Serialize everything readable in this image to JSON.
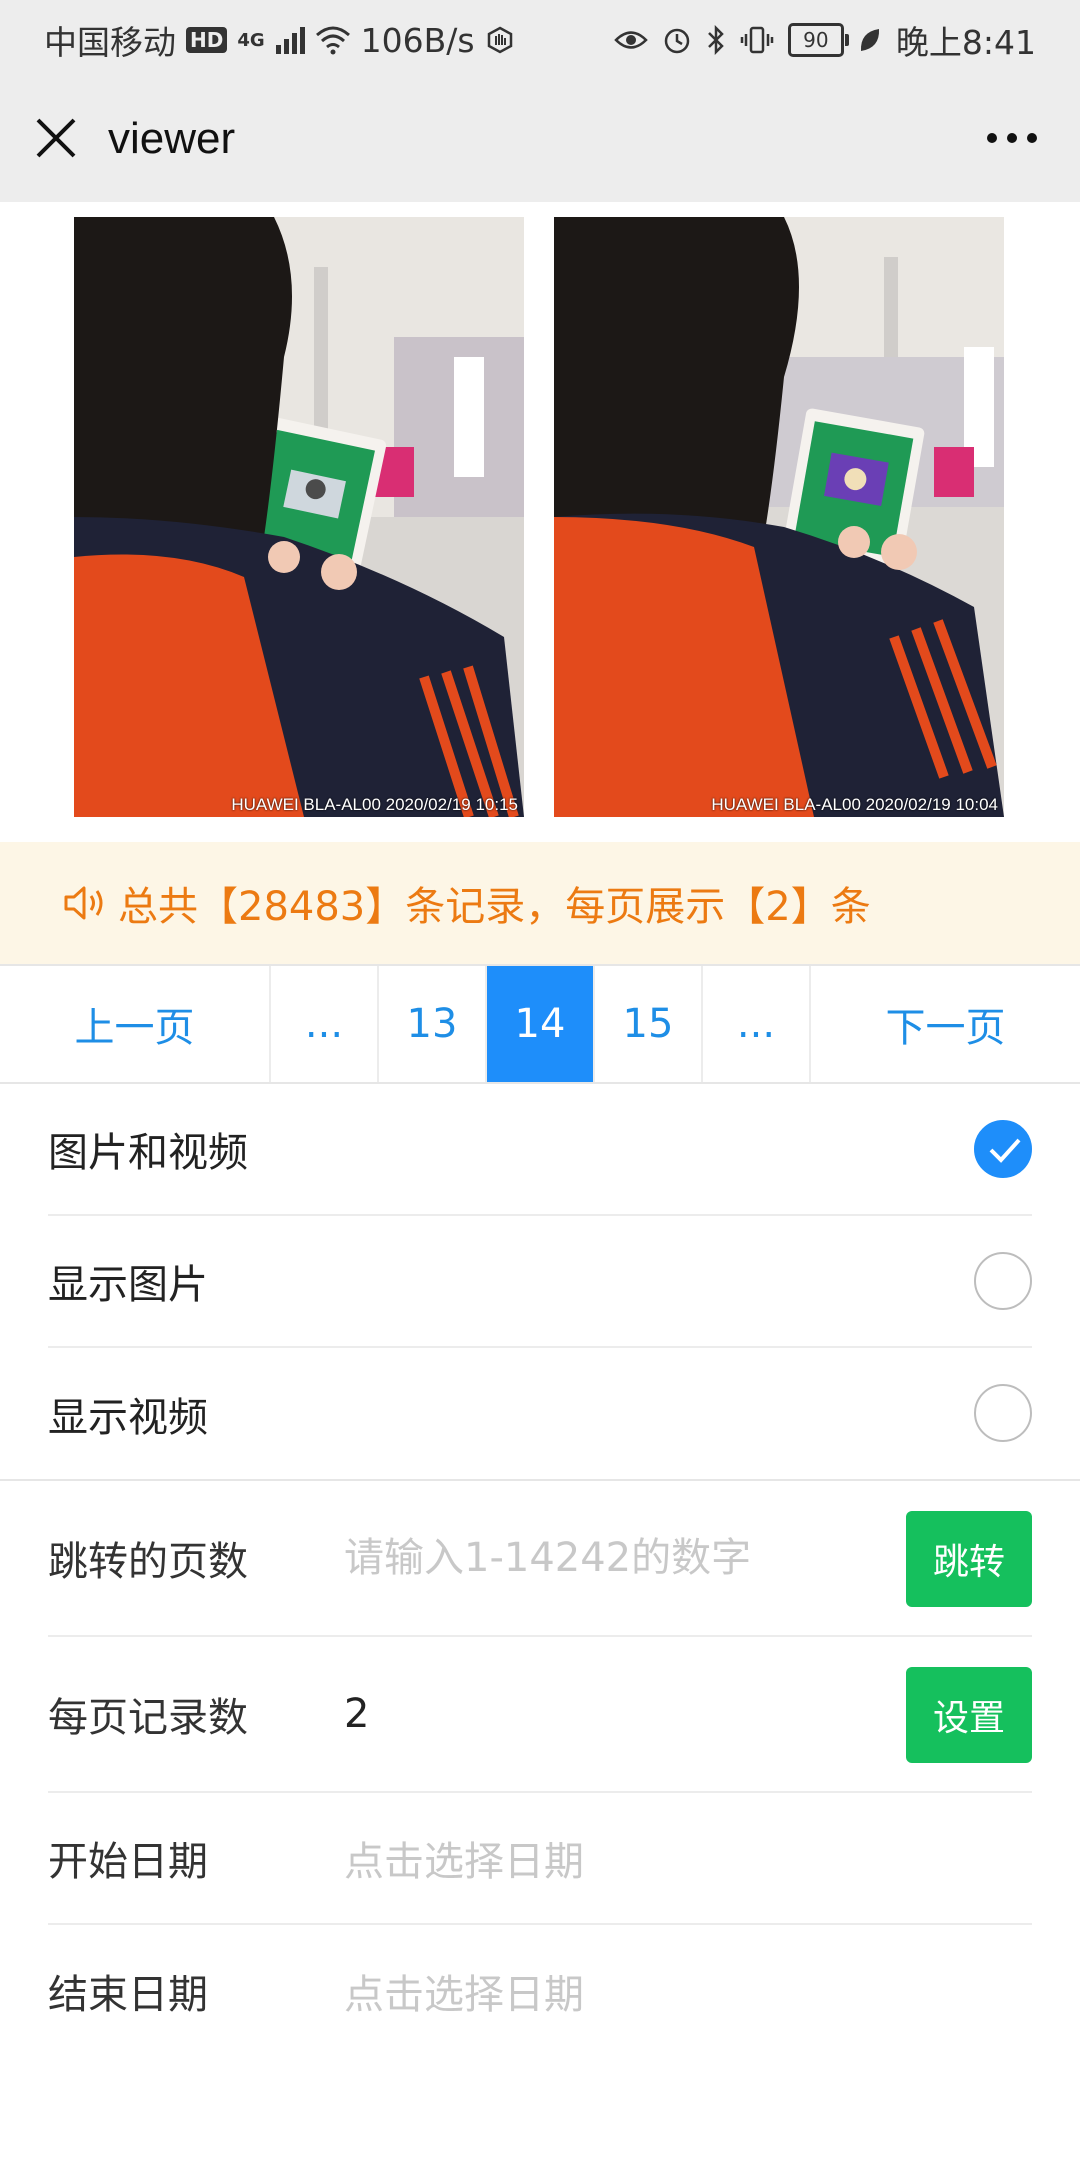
{
  "status_bar": {
    "carrier": "中国移动",
    "hd_badge": "HD",
    "network": "4G",
    "speed": "106B/s",
    "battery": "90",
    "time": "晚上8:41"
  },
  "nav": {
    "title": "viewer"
  },
  "photos": [
    {
      "caption": "HUAWEI BLA-AL00 2020/02/19 10:15"
    },
    {
      "caption": "HUAWEI BLA-AL00 2020/02/19 10:04"
    }
  ],
  "notice": {
    "text": "总共【28483】条记录，每页展示【2】条"
  },
  "pager": {
    "prev": "上一页",
    "ellipsis_left": "...",
    "pages": [
      "13",
      "14",
      "15"
    ],
    "current": "14",
    "ellipsis_right": "...",
    "next": "下一页"
  },
  "filters": [
    {
      "label": "图片和视频",
      "checked": true
    },
    {
      "label": "显示图片",
      "checked": false
    },
    {
      "label": "显示视频",
      "checked": false
    }
  ],
  "form": {
    "jump_label": "跳转的页数",
    "jump_placeholder": "请输入1-14242的数字",
    "jump_button": "跳转",
    "per_page_label": "每页记录数",
    "per_page_value": "2",
    "set_button": "设置",
    "start_label": "开始日期",
    "start_placeholder": "点击选择日期",
    "end_label": "结束日期",
    "end_placeholder": "点击选择日期"
  },
  "colors": {
    "accent_blue": "#1e8efa",
    "notice_orange": "#ec7a12",
    "notice_bg": "#fdf6e6",
    "button_green": "#15c05d"
  }
}
